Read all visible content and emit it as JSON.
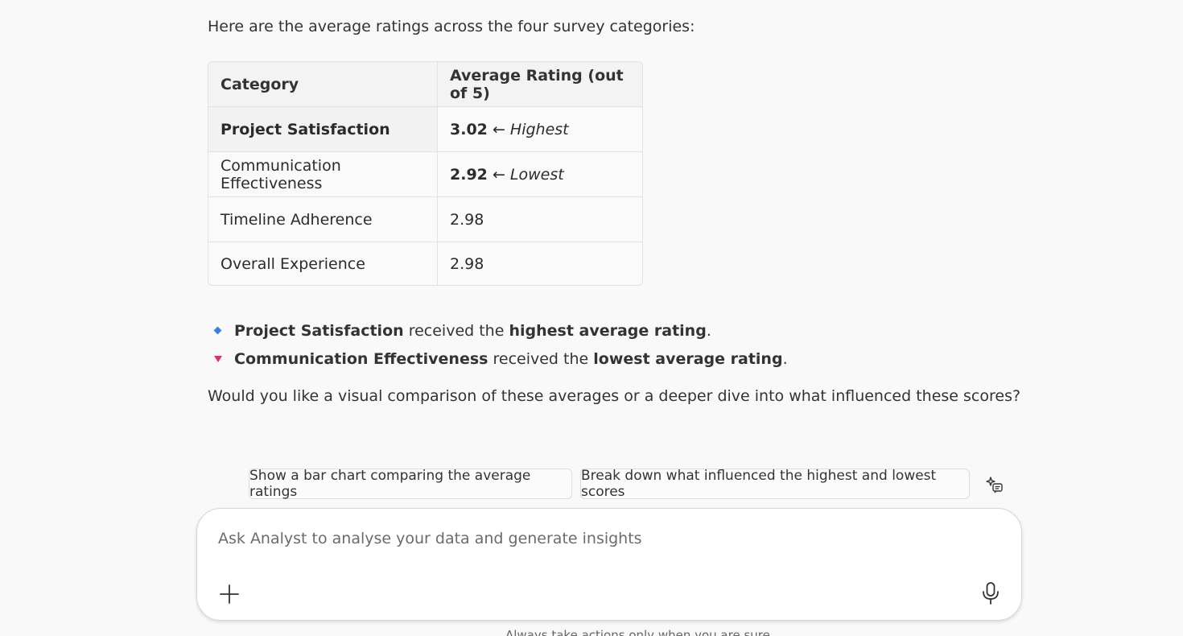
{
  "intro_text": "Here are the average ratings across the four survey categories:",
  "table": {
    "headers": [
      "Category",
      "Average Rating (out of 5)"
    ],
    "rows": [
      {
        "category": "Project Satisfaction",
        "rating": "3.02",
        "note": "Highest"
      },
      {
        "category": "Communication Effectiveness",
        "rating": "2.92",
        "note": "Lowest"
      },
      {
        "category": "Timeline Adherence",
        "rating": "2.98",
        "note": ""
      },
      {
        "category": "Overall Experience",
        "rating": "2.98",
        "note": ""
      }
    ],
    "arrow": "←"
  },
  "bullets": [
    {
      "strong1": "Project Satisfaction",
      "mid": " received the ",
      "strong2": "highest average rating",
      "end": "."
    },
    {
      "strong1": "Communication Effectiveness",
      "mid": " received the ",
      "strong2": "lowest average rating",
      "end": "."
    }
  ],
  "question": "Would you like a visual comparison of these averages or a deeper dive into what influenced these scores?",
  "suggestions": [
    "Show a bar chart comparing the average ratings",
    "Break down what influenced the highest and lowest scores"
  ],
  "composer": {
    "placeholder": "Ask Analyst to analyse your data and generate insights",
    "value": ""
  },
  "footnote": "Always take actions only when you are sure",
  "colors": {
    "highest_marker": "#3b82d6",
    "lowest_marker": "#d6336c"
  },
  "icons": {
    "bullet_1": "diamond-icon",
    "bullet_2": "triangle-down-icon",
    "suggestions": "sparkle-chat-icon",
    "add": "plus-icon",
    "voice": "microphone-icon"
  }
}
